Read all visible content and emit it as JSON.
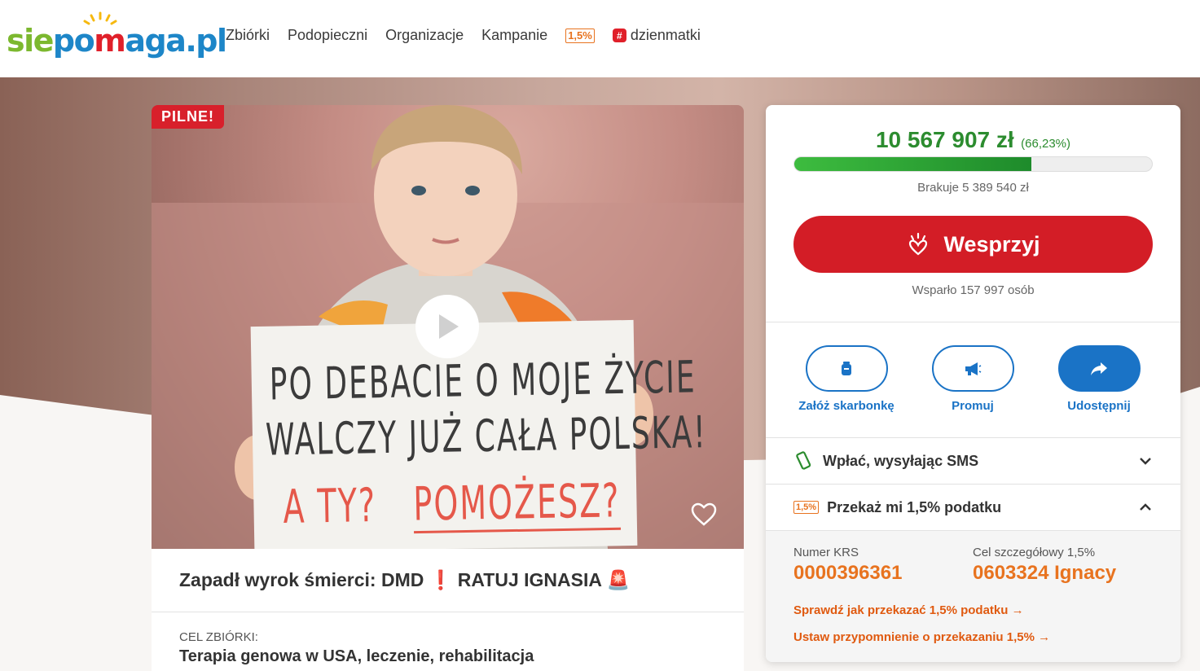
{
  "header": {
    "logo": {
      "p1": "sie",
      "p2": "po",
      "p3": "m",
      "p4": "aga.pl"
    },
    "nav": [
      "Zbiórki",
      "Podopieczni",
      "Organizacje",
      "Kampanie"
    ],
    "tax_badge": "1,5%",
    "hashtag_link": "dzienmatki"
  },
  "campaign": {
    "urgent_badge": "PILNE!",
    "sign_text": {
      "line1": "PO DEBACIE O MOJE ŻYCIE",
      "line2": "WALCZY JUŻ CAŁA POLSKA!",
      "line3a": "A TY?",
      "line3b": "POMOŻESZ?"
    },
    "title": "Zapadł wyrok śmierci: DMD ❗ RATUJ IGNASIA 🚨",
    "goal_label": "CEL ZBIÓRKI:",
    "goal": "Terapia genowa w USA, leczenie, rehabilitacja"
  },
  "panel": {
    "amount": "10 567 907 zł",
    "percent": "(66,23%)",
    "progress_fraction": 0.6623,
    "missing": "Brakuje 5 389 540 zł",
    "donate_label": "Wesprzyj",
    "supported": "Wsparło 157 997 osób",
    "actions": [
      {
        "label": "Załóż skarbonkę",
        "icon": "piggy-bank-icon"
      },
      {
        "label": "Promuj",
        "icon": "megaphone-icon"
      },
      {
        "label": "Udostępnij",
        "icon": "share-icon"
      }
    ],
    "sms_label": "Wpłać, wysyłając SMS",
    "tax_badge": "1,5%",
    "tax_label": "Przekaż mi 1,5% podatku",
    "krs_label": "Numer KRS",
    "krs": "0000396361",
    "cel_label": "Cel szczegółowy 1,5%",
    "cel": "0603324 Ignacy",
    "link1": "Sprawdź jak przekazać 1,5% podatku",
    "link2": "Ustaw przypomnienie o przekazaniu 1,5%"
  },
  "colors": {
    "green": "#2c8c2f",
    "red": "#d31d26",
    "blue": "#1a73c6",
    "orange": "#e8731f"
  }
}
